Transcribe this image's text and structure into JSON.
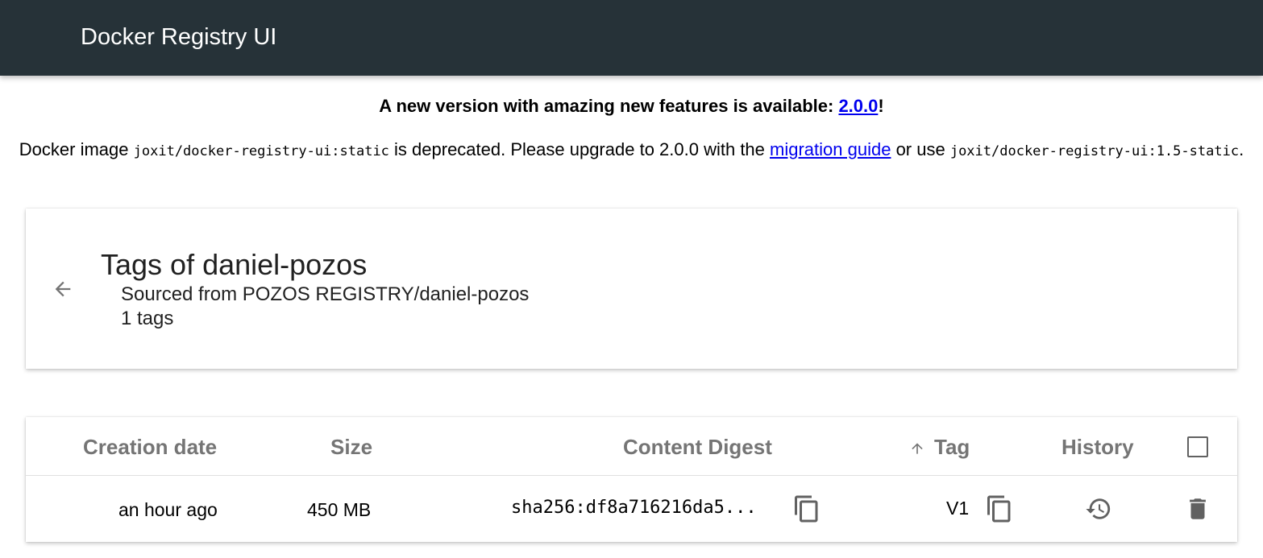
{
  "header": {
    "title": "Docker Registry UI"
  },
  "banner": {
    "headline_prefix": "A new version with amazing new features is available: ",
    "headline_link": "2.0.0",
    "headline_suffix": "!",
    "deprecation_prefix": "Docker image ",
    "deprecated_image": "joxit/docker-registry-ui:static",
    "deprecation_middle": " is deprecated. Please upgrade to 2.0.0 with the ",
    "migration_link": "migration guide",
    "deprecation_or": " or use ",
    "alternative_image": "joxit/docker-registry-ui:1.5-static",
    "deprecation_end": "."
  },
  "repo": {
    "title": "Tags of daniel-pozos",
    "sourced": "Sourced from POZOS REGISTRY/daniel-pozos",
    "count": "1 tags"
  },
  "table": {
    "headers": {
      "creation_date": "Creation date",
      "size": "Size",
      "content_digest": "Content Digest",
      "tag": "Tag",
      "history": "History"
    },
    "sort": {
      "column": "tag",
      "direction": "ascending"
    },
    "rows": [
      {
        "creation_date": "an hour ago",
        "size": "450 MB",
        "digest": "sha256:df8a716216da5...",
        "tag": "V1"
      }
    ]
  },
  "icons": {
    "back": "arrow-back-icon",
    "sort": "arrow-upward-icon",
    "copy": "content-copy-icon",
    "history": "history-icon",
    "delete": "delete-icon",
    "select_all": "checkbox-icon"
  },
  "colors": {
    "header_bg": "#263238",
    "link": "#0000ee",
    "header_text_muted": "#757575"
  }
}
